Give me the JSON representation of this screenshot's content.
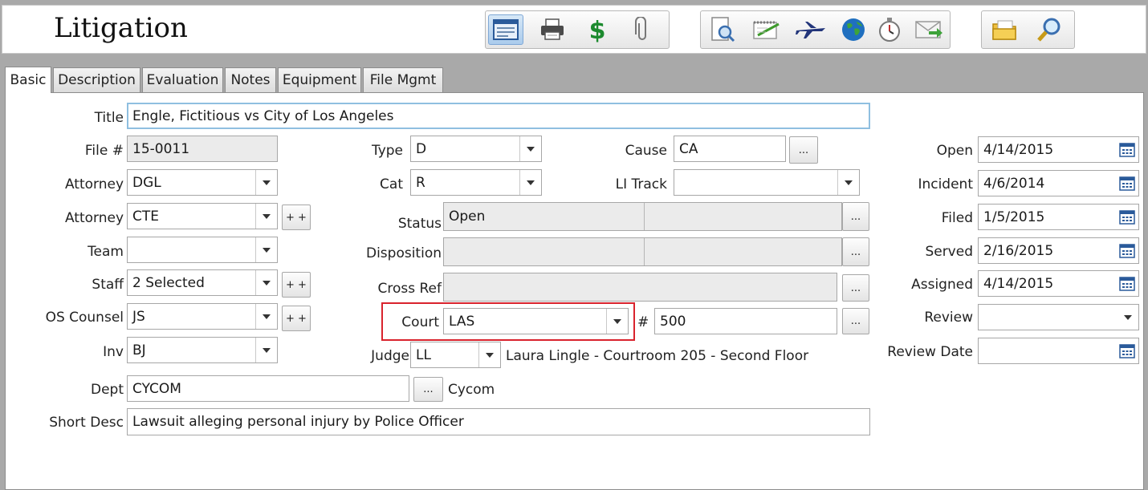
{
  "header": {
    "title": "Litigation"
  },
  "toolbar": {
    "group1": [
      "form-icon",
      "printer-icon",
      "dollar-icon",
      "paperclip-icon"
    ],
    "group2": [
      "magnifier-document-icon",
      "notepad-icon",
      "airplane-icon",
      "globe-icon",
      "stopwatch-icon",
      "email-arrow-icon"
    ],
    "group3": [
      "folder-icon",
      "search-key-icon"
    ]
  },
  "tabs": [
    "Basic",
    "Description",
    "Evaluation",
    "Notes",
    "Equipment",
    "File Mgmt"
  ],
  "form": {
    "title_label": "Title",
    "title_value": "Engle, Fictitious vs City of Los Angeles",
    "file_label": "File #",
    "file_value": "15-0011",
    "attorney1_label": "Attorney",
    "attorney1_value": "DGL",
    "attorney2_label": "Attorney",
    "attorney2_value": "CTE",
    "team_label": "Team",
    "team_value": "",
    "staff_label": "Staff",
    "staff_value": "2 Selected",
    "oscounsel_label": "OS Counsel",
    "oscounsel_value": "JS",
    "inv_label": "Inv",
    "inv_value": "BJ",
    "dept_label": "Dept",
    "dept_value": "CYCOM",
    "dept_name": "Cycom",
    "shortdesc_label": "Short Desc",
    "shortdesc_value": "Lawsuit alleging personal injury by Police Officer",
    "type_label": "Type",
    "type_value": "D",
    "cat_label": "Cat",
    "cat_value": "R",
    "status_label": "Status",
    "status_value": "Open",
    "disposition_label": "Disposition",
    "disposition_value": "",
    "crossref_label": "Cross Ref",
    "crossref_value": "",
    "court_label": "Court",
    "court_value": "LAS",
    "num_label": "#",
    "num_value": "500",
    "judge_label": "Judge",
    "judge_value": "LL",
    "judge_name": "Laura Lingle - Courtroom 205 - Second Floor",
    "cause_label": "Cause",
    "cause_value": "CA",
    "litrack_label": "LI Track",
    "litrack_value": "",
    "open_label": "Open",
    "open_value": "4/14/2015",
    "incident_label": "Incident",
    "incident_value": "4/6/2014",
    "filed_label": "Filed",
    "filed_value": "1/5/2015",
    "served_label": "Served",
    "served_value": "2/16/2015",
    "assigned_label": "Assigned",
    "assigned_value": "4/14/2015",
    "review_label": "Review",
    "review_value": "",
    "reviewdate_label": "Review Date",
    "reviewdate_value": ""
  },
  "buttons": {
    "ellipsis": "...",
    "plusplus": "+ +"
  },
  "colors": {
    "highlight": "#d9232d",
    "focus_border": "#8fbfe0",
    "readonly_bg": "#ebebeb"
  }
}
